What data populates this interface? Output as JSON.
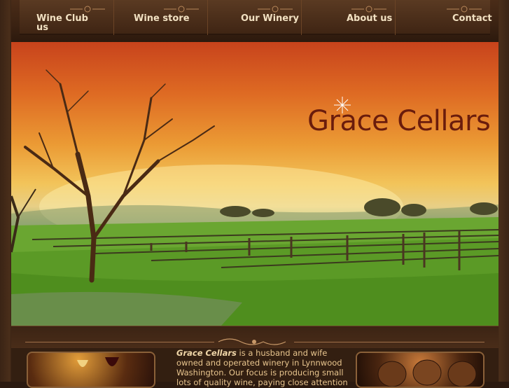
{
  "nav": {
    "items": [
      {
        "label": "Wine Club us"
      },
      {
        "label": "Wine store"
      },
      {
        "label": "Our Winery"
      },
      {
        "label": "About us"
      },
      {
        "label": "Contact"
      }
    ]
  },
  "hero": {
    "brand": "Grace Cellars"
  },
  "intro": {
    "brand_name": "Grace Cellars",
    "text": " is a husband and wife owned and operated winery in Lynnwood Washington. Our focus is producing small lots of quality wine, paying close attention"
  },
  "colors": {
    "brand_text": "#6a1c0c",
    "nav_text": "#f2e1c2",
    "intro_text": "#e8c58e"
  }
}
